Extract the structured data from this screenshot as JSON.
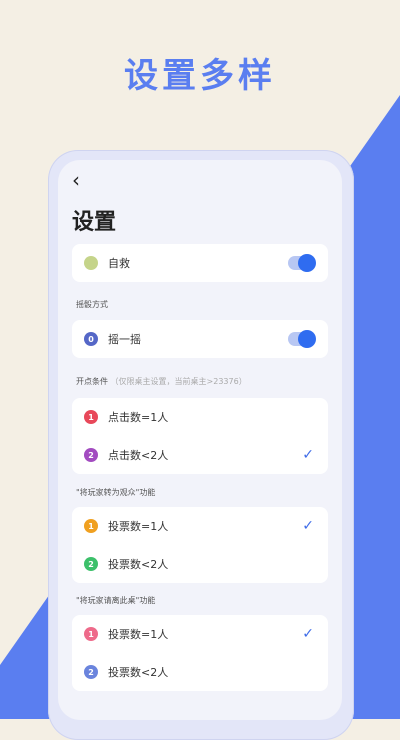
{
  "headline": "设置多样",
  "header": {
    "back_icon": "chevron-left-icon",
    "title": "设置"
  },
  "items": {
    "self": {
      "label": "自救",
      "dot_color": "#c5d48a",
      "dot_text": ""
    },
    "shake_method": {
      "label": "摇一摇",
      "dot_color": "#5567c7",
      "dot_text": "0"
    }
  },
  "sections": {
    "method": "摇骰方式",
    "open_condition": "开点条件",
    "open_condition_note": "（仅限桌主设置，当前桌主>23376）",
    "turn_watch": "\"将玩家转为观众\"功能",
    "invite_leave": "\"将玩家请离此桌\"功能"
  },
  "open_options": [
    {
      "label": "点击数=1人",
      "dot_color": "#e8485a",
      "dot_text": "1",
      "checked": false
    },
    {
      "label": "点击数<2人",
      "dot_color": "#a24bc0",
      "dot_text": "2",
      "checked": true
    }
  ],
  "watch_options": [
    {
      "label": "投票数=1人",
      "dot_color": "#f0a020",
      "dot_text": "1",
      "checked": true
    },
    {
      "label": "投票数<2人",
      "dot_color": "#3cc06a",
      "dot_text": "2",
      "checked": false
    }
  ],
  "leave_options": [
    {
      "label": "投票数=1人",
      "dot_color": "#ee6a8a",
      "dot_text": "1",
      "checked": true
    },
    {
      "label": "投票数<2人",
      "dot_color": "#6a84dd",
      "dot_text": "2",
      "checked": false
    }
  ],
  "colors": {
    "accent": "#3f6ce8",
    "stripe": "#5a7ef0"
  }
}
